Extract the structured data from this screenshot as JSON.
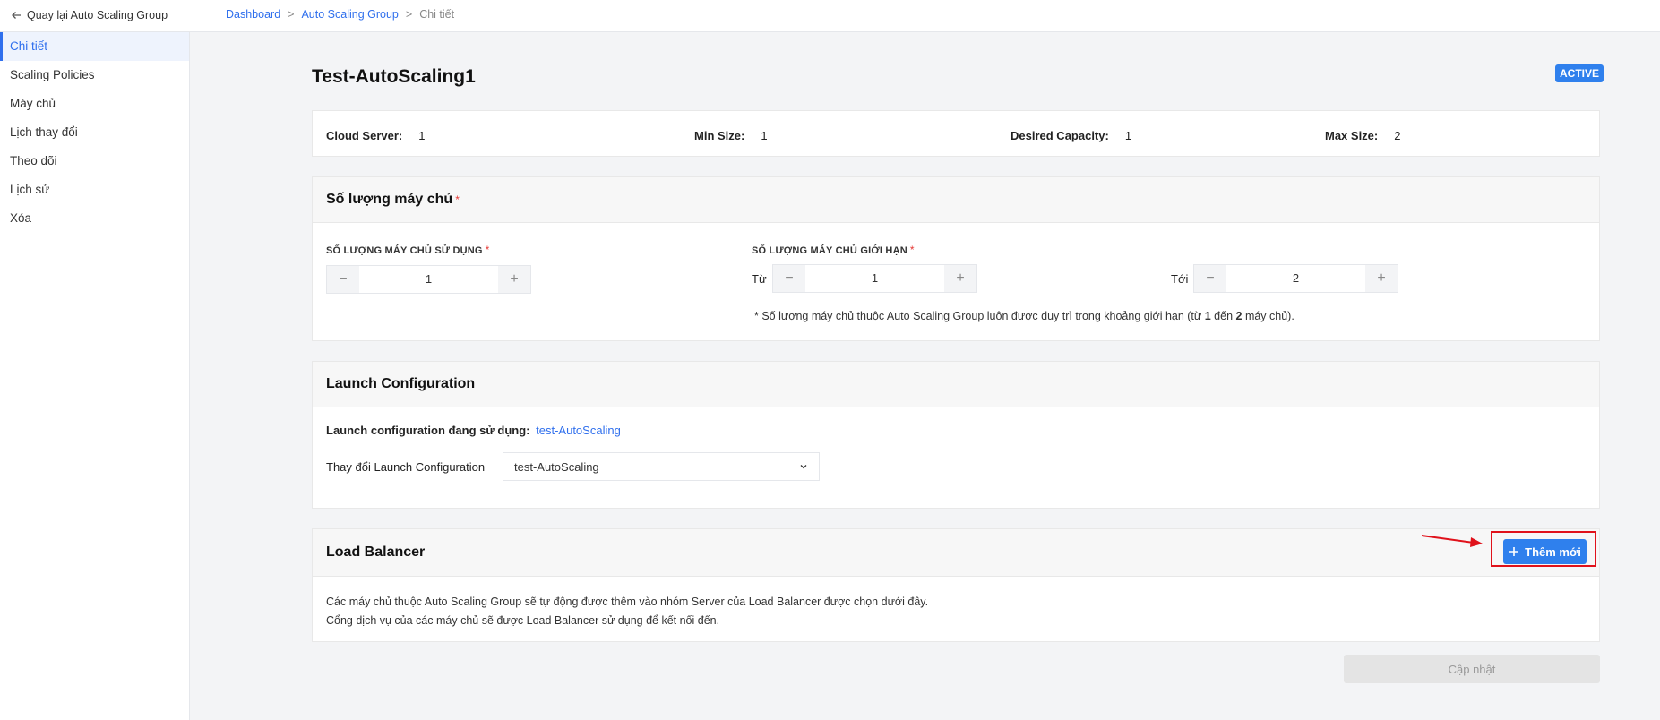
{
  "topbar": {
    "back_label": "Quay lại Auto Scaling Group",
    "breadcrumb": [
      "Dashboard",
      "Auto Scaling Group",
      "Chi tiết"
    ]
  },
  "sidebar": {
    "items": [
      {
        "label": "Chi tiết"
      },
      {
        "label": "Scaling Policies"
      },
      {
        "label": "Máy chủ"
      },
      {
        "label": "Lịch thay đổi"
      },
      {
        "label": "Theo dõi"
      },
      {
        "label": "Lịch sử"
      },
      {
        "label": "Xóa"
      }
    ]
  },
  "page": {
    "title": "Test-AutoScaling1",
    "status": "ACTIVE"
  },
  "summary": {
    "cloud_server_label": "Cloud Server:",
    "cloud_server_value": "1",
    "min_size_label": "Min Size:",
    "min_size_value": "1",
    "desired_label": "Desired Capacity:",
    "desired_value": "1",
    "max_size_label": "Max Size:",
    "max_size_value": "2"
  },
  "capacity": {
    "title": "Số lượng máy chủ",
    "used_label": "SỐ LƯỢNG MÁY CHỦ SỬ DỤNG",
    "used_value": "1",
    "limit_label": "SỐ LƯỢNG MÁY CHỦ GIỚI HẠN",
    "from_label": "Từ",
    "from_value": "1",
    "to_label": "Tới",
    "to_value": "2",
    "note_prefix": "* Số lượng máy chủ thuộc Auto Scaling Group luôn được duy trì trong khoảng giới hạn (từ ",
    "note_min": "1",
    "note_mid": " đến ",
    "note_max": "2",
    "note_suffix": " máy chủ)."
  },
  "launch_config": {
    "title": "Launch Configuration",
    "current_label": "Launch configuration đang sử dụng:",
    "current_value": "test-AutoScaling",
    "change_label": "Thay đổi Launch Configuration",
    "selected": "test-AutoScaling"
  },
  "load_balancer": {
    "title": "Load Balancer",
    "add_label": "Thêm mới",
    "desc_line1": "Các máy chủ thuộc Auto Scaling Group sẽ tự động được thêm vào nhóm Server của Load Balancer được chọn dưới đây.",
    "desc_line2": "Cổng dịch vụ của các máy chủ sẽ được Load Balancer sử dụng để kết nối đến."
  },
  "footer": {
    "update_label": "Cập nhật"
  },
  "colors": {
    "accent": "#2f80ed",
    "highlight": "#e0121b"
  }
}
